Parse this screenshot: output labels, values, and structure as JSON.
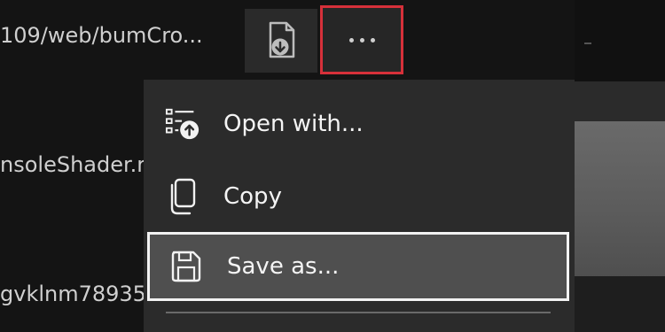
{
  "files": [
    {
      "name": "109/web/bumCro..."
    },
    {
      "name": "nsoleShader.r"
    },
    {
      "name": "gvklnm78935"
    }
  ],
  "toolbar": {
    "download_icon": "file-download-icon",
    "more_icon": "more-horizontal-icon"
  },
  "menu": {
    "items": [
      {
        "label": "Open with...",
        "icon": "open-with-icon"
      },
      {
        "label": "Copy",
        "icon": "copy-icon"
      },
      {
        "label": "Save as...",
        "icon": "save-icon"
      }
    ]
  },
  "colors": {
    "highlight_border": "#d6303a",
    "focus_border": "#f2f2f2",
    "menu_bg": "#2b2b2b",
    "focus_bg": "#4f4f4f"
  }
}
